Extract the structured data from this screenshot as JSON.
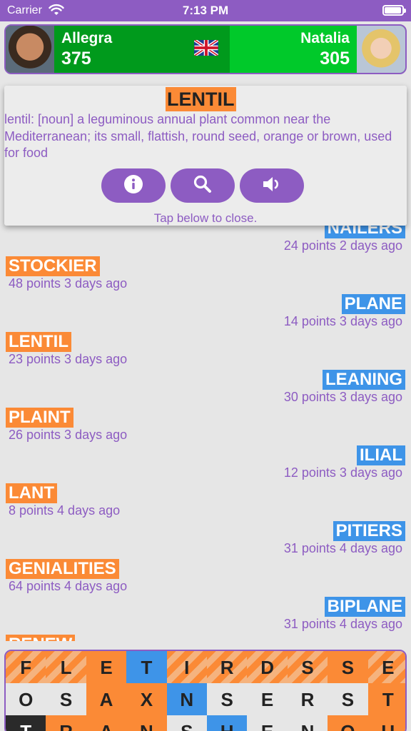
{
  "status": {
    "carrier": "Carrier",
    "time": "7:13 PM"
  },
  "players": {
    "left": {
      "name": "Allegra",
      "score": "375"
    },
    "right": {
      "name": "Natalia",
      "score": "305"
    },
    "language_flag": "uk-flag-icon"
  },
  "popup": {
    "word": "LENTIL",
    "definition": "lentil: [noun] a leguminous annual plant common near the Mediterranean; its small, flattish, round seed, orange or brown, used for food",
    "buttons": [
      "info-icon",
      "search-icon",
      "speaker-icon"
    ],
    "hint": "Tap below to close."
  },
  "words": [
    {
      "word": "NAILERS",
      "meta": "24 points 2 days ago",
      "side": "right"
    },
    {
      "word": "STOCKIER",
      "meta": "48 points 3 days ago",
      "side": "left"
    },
    {
      "word": "PLANE",
      "meta": "14 points 3 days ago",
      "side": "right"
    },
    {
      "word": "LENTIL",
      "meta": "23 points 3 days ago",
      "side": "left"
    },
    {
      "word": "LEANING",
      "meta": "30 points 3 days ago",
      "side": "right"
    },
    {
      "word": "PLAINT",
      "meta": "26 points 3 days ago",
      "side": "left"
    },
    {
      "word": "ILIAL",
      "meta": "12 points 3 days ago",
      "side": "right"
    },
    {
      "word": "LANT",
      "meta": "8 points 4 days ago",
      "side": "left"
    },
    {
      "word": "PITIERS",
      "meta": "31 points 4 days ago",
      "side": "right"
    },
    {
      "word": "GENIALITIES",
      "meta": "64 points 4 days ago",
      "side": "left"
    },
    {
      "word": "BIPLANE",
      "meta": "31 points 4 days ago",
      "side": "right"
    },
    {
      "word": "RENEW",
      "meta": "",
      "side": "left"
    }
  ],
  "colors": {
    "accent": "#8d5cc2",
    "player_left": "#fb8a36",
    "player_right": "#3e94e8",
    "green_dark": "#009a1c",
    "green_light": "#00c92a"
  },
  "board": [
    [
      [
        "F",
        "os"
      ],
      [
        "L",
        "os"
      ],
      [
        "E",
        "o"
      ],
      [
        "T",
        "b"
      ],
      [
        "I",
        "os"
      ],
      [
        "R",
        "os"
      ],
      [
        "D",
        "os"
      ],
      [
        "S",
        "os"
      ],
      [
        "S",
        "o"
      ],
      [
        "E",
        "os"
      ]
    ],
    [
      [
        "O",
        "g"
      ],
      [
        "S",
        "g"
      ],
      [
        "A",
        "o"
      ],
      [
        "X",
        "o"
      ],
      [
        "N",
        "b"
      ],
      [
        "S",
        "g"
      ],
      [
        "E",
        "g"
      ],
      [
        "R",
        "g"
      ],
      [
        "S",
        "g"
      ],
      [
        "T",
        "o"
      ]
    ],
    [
      [
        "T",
        "k"
      ],
      [
        "R",
        "o"
      ],
      [
        "A",
        "o"
      ],
      [
        "N",
        "o"
      ],
      [
        "S",
        "g"
      ],
      [
        "H",
        "b"
      ],
      [
        "E",
        "g"
      ],
      [
        "N",
        "g"
      ],
      [
        "O",
        "o"
      ],
      [
        "U",
        "o"
      ]
    ]
  ]
}
